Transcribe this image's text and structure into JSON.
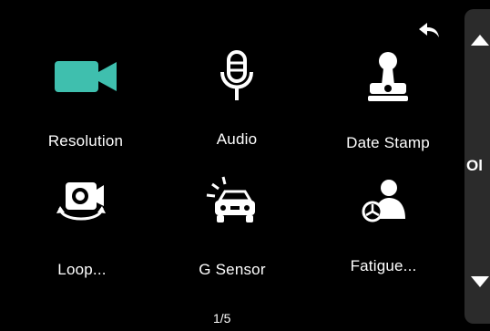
{
  "menu": {
    "items": [
      {
        "label": "Resolution",
        "icon": "video-camera-icon"
      },
      {
        "label": "Audio",
        "icon": "microphone-icon"
      },
      {
        "label": "Date Stamp",
        "icon": "stamp-icon"
      },
      {
        "label": "Loop...",
        "icon": "loop-record-icon"
      },
      {
        "label": "G Sensor",
        "icon": "car-impact-icon"
      },
      {
        "label": "Fatigue...",
        "icon": "driver-fatigue-icon"
      }
    ]
  },
  "pager": {
    "text": "1/5"
  },
  "side": {
    "text": "Ol"
  },
  "colors": {
    "accent": "#3fbfae",
    "icon": "#ffffff",
    "background": "#000000"
  }
}
